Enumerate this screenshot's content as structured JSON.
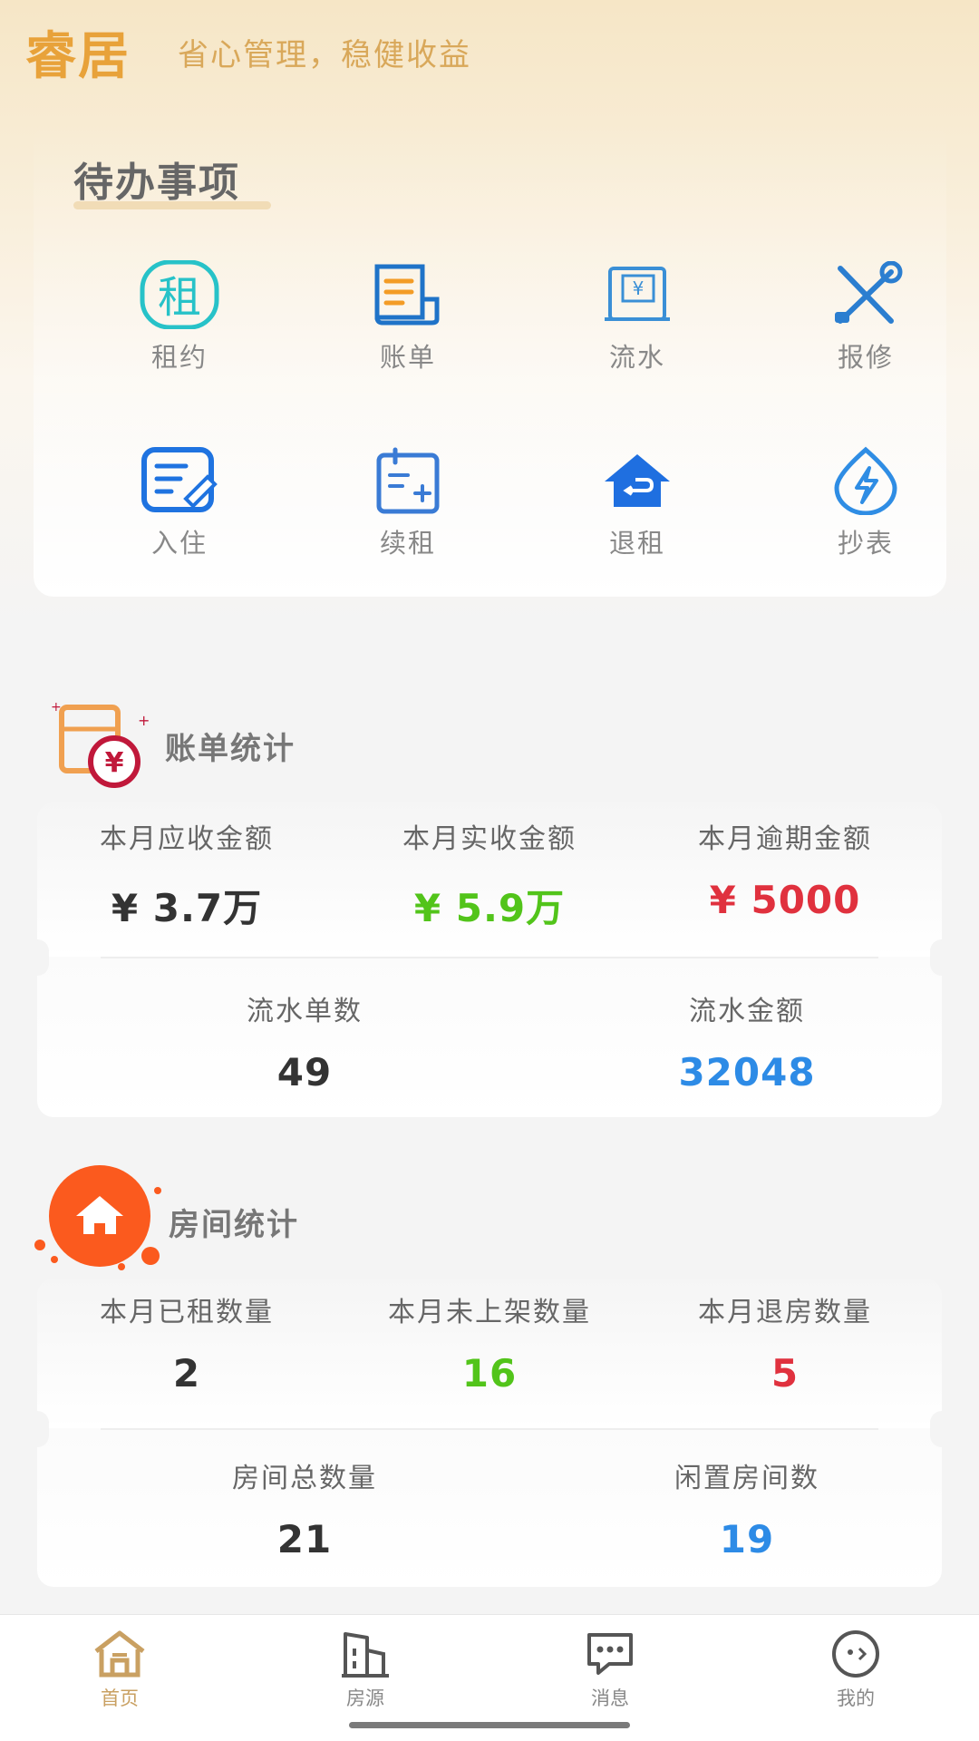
{
  "header": {
    "app_name": "睿居",
    "slogan": "省心管理，稳健收益"
  },
  "todo": {
    "title": "待办事项",
    "items": [
      {
        "label": "租约",
        "icon": "lease-icon"
      },
      {
        "label": "账单",
        "icon": "bill-icon"
      },
      {
        "label": "流水",
        "icon": "transaction-icon"
      },
      {
        "label": "报修",
        "icon": "repair-icon"
      },
      {
        "label": "入住",
        "icon": "checkin-icon"
      },
      {
        "label": "续租",
        "icon": "renew-icon"
      },
      {
        "label": "退租",
        "icon": "checkout-icon"
      },
      {
        "label": "抄表",
        "icon": "meter-icon"
      }
    ]
  },
  "bill_stats": {
    "title": "账单统计",
    "row1": [
      {
        "label": "本月应收金额",
        "value": "¥ 3.7万"
      },
      {
        "label": "本月实收金额",
        "value": "¥ 5.9万"
      },
      {
        "label": "本月逾期金额",
        "value": "¥ 5000"
      }
    ],
    "row2": [
      {
        "label": "流水单数",
        "value": "49"
      },
      {
        "label": "流水金额",
        "value": "32048"
      }
    ]
  },
  "room_stats": {
    "title": "房间统计",
    "row1": [
      {
        "label": "本月已租数量",
        "value": "2"
      },
      {
        "label": "本月未上架数量",
        "value": "16"
      },
      {
        "label": "本月退房数量",
        "value": "5"
      }
    ],
    "row2": [
      {
        "label": "房间总数量",
        "value": "21"
      },
      {
        "label": "闲置房间数",
        "value": "19"
      }
    ]
  },
  "tabbar": {
    "items": [
      {
        "label": "首页",
        "icon": "home-icon",
        "active": true
      },
      {
        "label": "房源",
        "icon": "building-icon",
        "active": false
      },
      {
        "label": "消息",
        "icon": "message-icon",
        "active": false
      },
      {
        "label": "我的",
        "icon": "profile-icon",
        "active": false
      }
    ]
  },
  "colors": {
    "accent": "#e8a23a",
    "green": "#52c41a",
    "red": "#e0313e",
    "blue": "#2d8be6",
    "tab_active": "#c9a062"
  }
}
